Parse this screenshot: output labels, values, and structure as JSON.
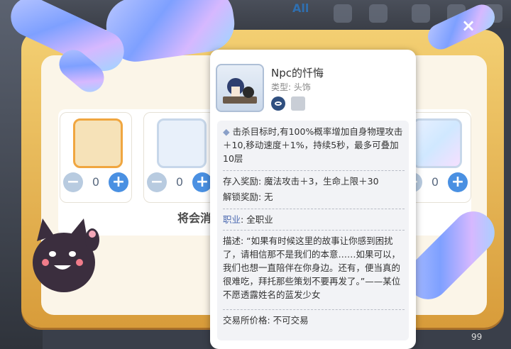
{
  "header": {
    "tab_all": "All"
  },
  "dialog": {
    "close_label": "×",
    "items": [
      {
        "quantity": "0"
      },
      {
        "quantity": "0"
      },
      {
        "quantity": "0"
      }
    ],
    "minus_label": "−",
    "plus_label": "+",
    "bottom_text": "将会消"
  },
  "tooltip": {
    "title": "Npc的忏悔",
    "type_label": "类型:",
    "type_value": "头饰",
    "bullet": "◆",
    "effect": "击杀目标时,有100%概率增加自身物理攻击＋10,移动速度＋1%，持续5秒，最多可叠加10层",
    "deposit_reward": "存入奖励: 魔法攻击＋3，生命上限＋30",
    "unlock_reward": "解锁奖励: 无",
    "job_label": "职业",
    "job_value": ": 全职业",
    "description": "描述: “如果有时候这里的故事让你感到困扰了，请相信那不是我们的本意……如果可以，我们也想一直陪伴在你身边。还有，便当真的很难吃，拜托那些策划不要再发了。”——某位不愿透露姓名的蓝发少女",
    "trade": "交易所价格: 不可交易"
  },
  "corner_count": "99"
}
